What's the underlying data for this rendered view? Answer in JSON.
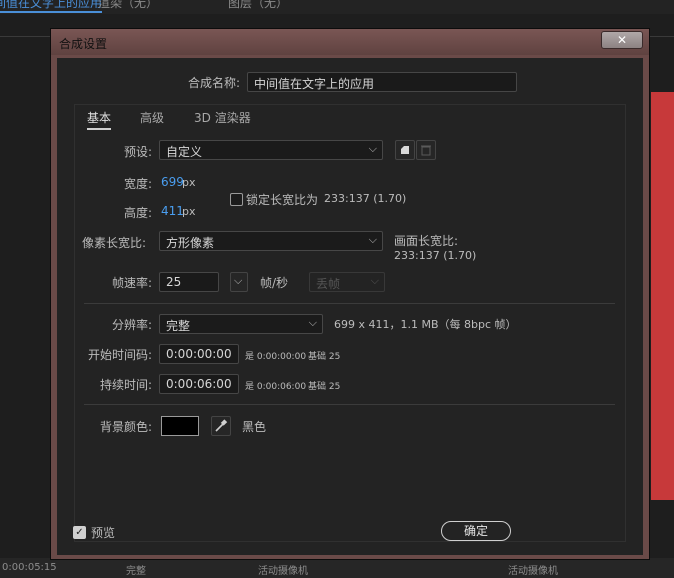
{
  "background": {
    "tabs": [
      "中间值在文字上的应用",
      "渲染（无）",
      "图层（无）"
    ],
    "bottom_timecode": "0:00:05:15",
    "bottom_label_1": "完整",
    "bottom_label_2": "活动摄像机",
    "bottom_label_3": "活动摄像机"
  },
  "dialog": {
    "title": "合成设置",
    "close_glyph": "✕",
    "comp_name_label": "合成名称:",
    "comp_name_value": "中间值在文字上的应用",
    "tabs": [
      "基本",
      "高级",
      "3D 渲染器"
    ],
    "preset": {
      "label": "预设:",
      "value": "自定义"
    },
    "width": {
      "label": "宽度:",
      "value": "699",
      "unit": "px"
    },
    "height": {
      "label": "高度:",
      "value": "411",
      "unit": "px"
    },
    "lock_aspect": {
      "label": "锁定长宽比为",
      "ratio": "233:137 (1.70)",
      "checked": false
    },
    "pixel_aspect": {
      "label": "像素长宽比:",
      "value": "方形像素"
    },
    "frame_aspect": {
      "label": "画面长宽比:",
      "value": "233:137 (1.70)"
    },
    "frame_rate": {
      "label": "帧速率:",
      "value": "25",
      "unit": "帧/秒",
      "drop_frame": "丢帧"
    },
    "resolution": {
      "label": "分辨率:",
      "value": "完整",
      "info": "699 x 411，1.1 MB（每 8bpc 帧）"
    },
    "start_timecode": {
      "label": "开始时间码:",
      "value": "0:00:00:00",
      "equals": "是 0:00:00:00",
      "base": "基础 25"
    },
    "duration": {
      "label": "持续时间:",
      "value": "0:00:06:00",
      "equals": "是 0:00:06:00",
      "base": "基础 25"
    },
    "bg_color": {
      "label": "背景颜色:",
      "color": "#000000",
      "name": "黑色"
    },
    "preview": {
      "label": "预览",
      "checked": true
    },
    "ok_label": "确定"
  },
  "colors": {
    "accent_blue": "#4a9ef0",
    "window_frame": "#6a4a48",
    "client_bg": "#232323"
  }
}
